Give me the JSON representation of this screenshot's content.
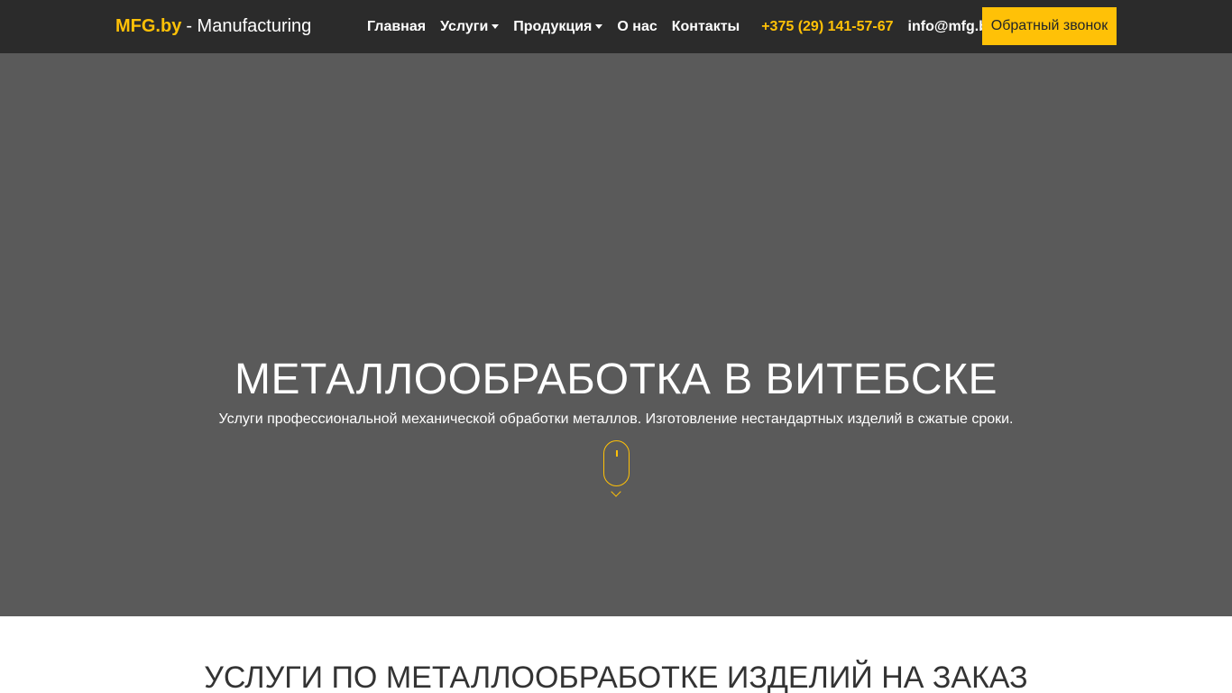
{
  "header": {
    "brand_accent": "MFG.by",
    "brand_rest": "- Manufacturing",
    "nav": {
      "home": "Главная",
      "services": "Услуги",
      "products": "Продукция",
      "about": "О нас",
      "contacts": "Контакты"
    },
    "phone": "+375 (29) 141-57-67",
    "email": "info@mfg.by",
    "callback_label": "Обратный звонок"
  },
  "hero": {
    "title": "МЕТАЛЛООБРАБОТКА В ВИТЕБСКЕ",
    "subtitle": "Услуги профессиональной механической обработки металлов. Изготовление нестандартных изделий в сжатые сроки.",
    "scroll_icon": "mouse-scroll-icon"
  },
  "services": {
    "heading": "УСЛУГИ ПО МЕТАЛЛООБРАБОТКЕ ИЗДЕЛИЙ НА ЗАКАЗ"
  },
  "colors": {
    "accent": "#ffc107",
    "navbar_bg": "#2b2b2b",
    "hero_bg": "#5a5a5a"
  }
}
